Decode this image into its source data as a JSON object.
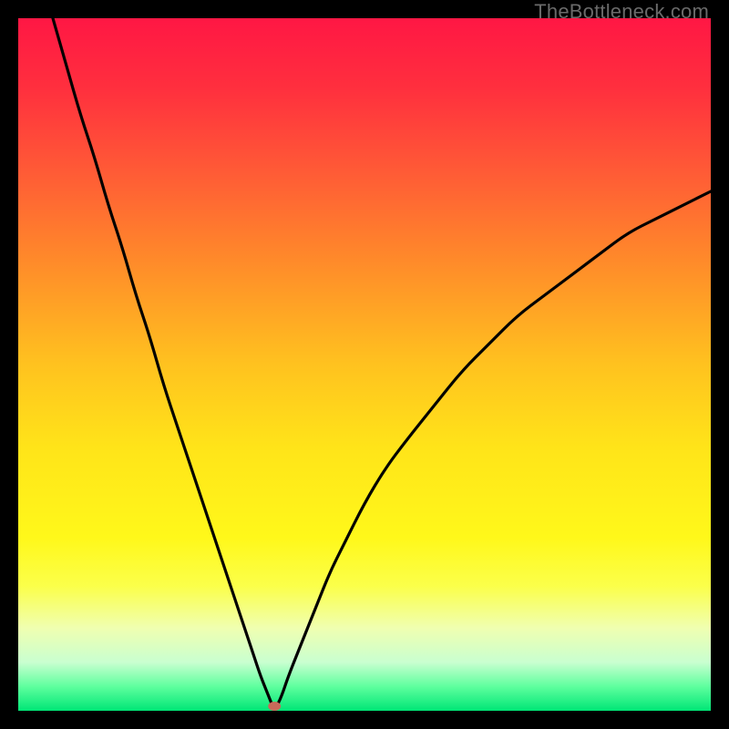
{
  "watermark": "TheBottleneck.com",
  "chart_data": {
    "type": "line",
    "title": "",
    "xlabel": "",
    "ylabel": "",
    "xlim": [
      0,
      100
    ],
    "ylim": [
      0,
      100
    ],
    "minimum_marker": {
      "x": 37,
      "y": 0,
      "color": "#c86a5a"
    },
    "gradient_stops": [
      {
        "offset": 0.0,
        "color": "#ff1744"
      },
      {
        "offset": 0.1,
        "color": "#ff2f3e"
      },
      {
        "offset": 0.22,
        "color": "#ff5a36"
      },
      {
        "offset": 0.35,
        "color": "#ff8a2a"
      },
      {
        "offset": 0.5,
        "color": "#ffc21f"
      },
      {
        "offset": 0.62,
        "color": "#ffe419"
      },
      {
        "offset": 0.75,
        "color": "#fff81a"
      },
      {
        "offset": 0.82,
        "color": "#fbff4a"
      },
      {
        "offset": 0.88,
        "color": "#f0ffb0"
      },
      {
        "offset": 0.93,
        "color": "#c9ffd0"
      },
      {
        "offset": 0.965,
        "color": "#5eff9e"
      },
      {
        "offset": 1.0,
        "color": "#00e676"
      }
    ],
    "series": [
      {
        "name": "bottleneck-curve",
        "x": [
          5,
          7,
          9,
          11,
          13,
          15,
          17,
          19,
          21,
          23,
          25,
          27,
          29,
          31,
          33,
          34,
          35,
          36,
          37,
          38,
          39,
          41,
          43,
          45,
          47,
          50,
          53,
          56,
          60,
          64,
          68,
          72,
          76,
          80,
          84,
          88,
          92,
          96,
          100
        ],
        "y": [
          100,
          93,
          86,
          80,
          73,
          67,
          60,
          54,
          47,
          41,
          35,
          29,
          23,
          17,
          11,
          8,
          5,
          2.5,
          0,
          2,
          5,
          10,
          15,
          20,
          24,
          30,
          35,
          39,
          44,
          49,
          53,
          57,
          60,
          63,
          66,
          69,
          71,
          73,
          75
        ]
      }
    ]
  }
}
